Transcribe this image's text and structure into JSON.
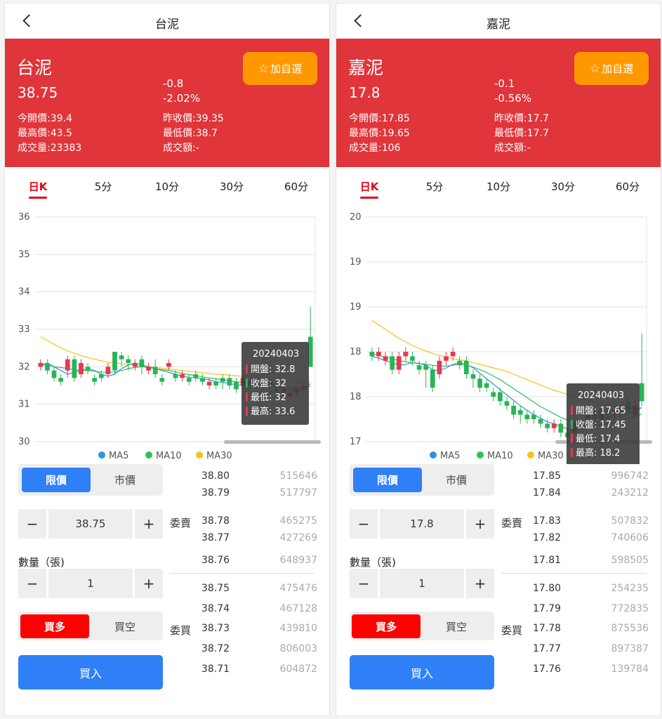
{
  "panels": [
    {
      "nav_title": "台泥",
      "quote": {
        "name": "台泥",
        "price": "38.75",
        "change": "-0.8",
        "change_pct": "-2.02%",
        "open": "今開價:39.4",
        "prev_close": "昨收價:39.35",
        "high": "最高價:43.5",
        "low": "最低價:38.7",
        "volume": "成交量:23383",
        "amount": "成交額:-",
        "fav_label": "加自選"
      },
      "tabs": [
        "日K",
        "5分",
        "10分",
        "30分",
        "60分"
      ],
      "chart_data": {
        "type": "candlestick",
        "y_ticks": [
          "36",
          "35",
          "34",
          "33",
          "32",
          "31",
          "30"
        ],
        "ylim": [
          30,
          36
        ],
        "candles": [
          [
            32.0,
            32.1,
            31.9,
            32.2
          ],
          [
            32.1,
            31.9,
            31.8,
            32.2
          ],
          [
            31.9,
            31.7,
            31.6,
            32.0
          ],
          [
            31.7,
            31.6,
            31.5,
            31.8
          ],
          [
            31.9,
            32.2,
            31.7,
            32.3
          ],
          [
            32.2,
            31.7,
            31.6,
            32.3
          ],
          [
            31.8,
            32.1,
            31.7,
            32.2
          ],
          [
            32.0,
            31.9,
            31.8,
            32.1
          ],
          [
            31.7,
            31.6,
            31.5,
            31.8
          ],
          [
            31.8,
            31.7,
            31.6,
            31.9
          ],
          [
            31.8,
            32.0,
            31.7,
            32.1
          ],
          [
            32.4,
            31.9,
            31.8,
            32.4
          ],
          [
            32.3,
            32.2,
            32.0,
            32.4
          ],
          [
            32.2,
            32.1,
            31.9,
            32.3
          ],
          [
            32.0,
            32.1,
            31.9,
            32.2
          ],
          [
            32.2,
            32.0,
            31.8,
            32.3
          ],
          [
            31.9,
            32.0,
            31.8,
            32.1
          ],
          [
            32.0,
            31.8,
            31.7,
            32.2
          ],
          [
            31.7,
            31.6,
            31.5,
            31.8
          ],
          [
            32.0,
            32.1,
            31.9,
            32.2
          ],
          [
            31.8,
            31.7,
            31.6,
            31.9
          ],
          [
            31.7,
            31.8,
            31.6,
            31.9
          ],
          [
            31.7,
            31.6,
            31.5,
            31.8
          ],
          [
            31.8,
            31.7,
            31.6,
            31.9
          ],
          [
            31.7,
            31.6,
            31.5,
            31.8
          ],
          [
            31.5,
            31.6,
            31.4,
            31.7
          ],
          [
            31.6,
            31.5,
            31.4,
            31.7
          ],
          [
            31.7,
            31.6,
            31.4,
            31.8
          ],
          [
            31.7,
            31.5,
            31.4,
            31.8
          ],
          [
            31.6,
            31.4,
            31.3,
            31.7
          ],
          [
            31.5,
            31.7,
            31.4,
            31.8
          ],
          [
            31.6,
            31.5,
            31.4,
            31.7
          ],
          [
            31.6,
            31.7,
            31.5,
            31.8
          ],
          [
            31.7,
            31.5,
            31.4,
            31.8
          ],
          [
            31.6,
            31.5,
            31.3,
            31.6
          ],
          [
            31.4,
            31.3,
            31.2,
            31.5
          ],
          [
            31.3,
            31.4,
            31.2,
            31.5
          ],
          [
            31.2,
            31.3,
            31.1,
            31.4
          ],
          [
            31.3,
            31.4,
            31.2,
            31.5
          ],
          [
            31.4,
            31.5,
            31.3,
            31.6
          ],
          [
            32.8,
            32.0,
            32.0,
            33.6
          ]
        ],
        "ma5": [
          32.0,
          32.1,
          32.0,
          31.9,
          31.8,
          31.85,
          31.9,
          31.95,
          31.9,
          31.8,
          31.75,
          31.8,
          31.95,
          32.05,
          32.1,
          32.05,
          32.0,
          31.95,
          31.9,
          31.85,
          31.8,
          31.75,
          31.72,
          31.7,
          31.68,
          31.65,
          31.6,
          31.58,
          31.55,
          31.52,
          31.5,
          31.52,
          31.55,
          31.55,
          31.5,
          31.45,
          31.42,
          31.38,
          31.35,
          31.4,
          31.55
        ],
        "ma10": [
          32.1,
          32.05,
          32.0,
          31.98,
          31.95,
          31.92,
          31.9,
          31.9,
          31.88,
          31.86,
          31.85,
          31.86,
          31.9,
          31.95,
          31.98,
          32.0,
          31.98,
          31.95,
          31.92,
          31.9,
          31.86,
          31.82,
          31.79,
          31.76,
          31.73,
          31.7,
          31.68,
          31.65,
          31.62,
          31.6,
          31.58,
          31.57,
          31.56,
          31.55,
          31.52,
          31.5,
          31.47,
          31.44,
          31.42,
          31.42,
          31.48
        ],
        "ma30": [
          32.8,
          32.7,
          32.6,
          32.5,
          32.42,
          32.36,
          32.3,
          32.25,
          32.2,
          32.16,
          32.12,
          32.1,
          32.08,
          32.06,
          32.04,
          32.02,
          32.0,
          31.98,
          31.96,
          31.94,
          31.92,
          31.9,
          31.88,
          31.86,
          31.84,
          31.82,
          31.8,
          31.79,
          31.78,
          31.76,
          31.74,
          31.72,
          31.7,
          31.68,
          31.66,
          31.64,
          31.62,
          31.6,
          31.58,
          31.58,
          31.6
        ],
        "tooltip": {
          "date": "20240403",
          "open": "開盤: 32.8",
          "close": "收盤: 32",
          "low": "最低: 32",
          "high": "最高: 33.6"
        },
        "legend": [
          "MA5",
          "MA10",
          "MA30"
        ]
      },
      "order": {
        "type_limit": "限價",
        "type_market": "市價",
        "price_value": "38.75",
        "qty_label": "數量（張)",
        "qty_value": "1",
        "side_long": "買多",
        "side_short": "買空",
        "buy_label": "買入",
        "minus": "−",
        "plus": "+"
      },
      "book": {
        "ask_label": "委賣",
        "bid_label": "委買",
        "asks": [
          [
            "38.80",
            "515646"
          ],
          [
            "38.79",
            "517797"
          ],
          [
            "38.78",
            "465275"
          ],
          [
            "38.77",
            "427269"
          ],
          [
            "38.76",
            "648937"
          ]
        ],
        "bids": [
          [
            "38.75",
            "475476"
          ],
          [
            "38.74",
            "467128"
          ],
          [
            "38.73",
            "439810"
          ],
          [
            "38.72",
            "806003"
          ],
          [
            "38.71",
            "604872"
          ]
        ]
      }
    },
    {
      "nav_title": "嘉泥",
      "quote": {
        "name": "嘉泥",
        "price": "17.8",
        "change": "-0.1",
        "change_pct": "-0.56%",
        "open": "今開價:17.85",
        "prev_close": "昨收價:17.7",
        "high": "最高價:19.65",
        "low": "最低價:17.7",
        "volume": "成交量:106",
        "amount": "成交額:-",
        "fav_label": "加自選"
      },
      "tabs": [
        "日K",
        "5分",
        "10分",
        "30分",
        "60分"
      ],
      "chart_data": {
        "type": "candlestick",
        "y_ticks": [
          "20",
          "19",
          "19",
          "18",
          "18",
          "17"
        ],
        "ylim": [
          17,
          19.5
        ],
        "candles": [
          [
            18.0,
            17.95,
            17.9,
            18.05
          ],
          [
            17.95,
            18.0,
            17.9,
            18.05
          ],
          [
            17.9,
            17.95,
            17.85,
            18.0
          ],
          [
            17.95,
            17.8,
            17.75,
            18.0
          ],
          [
            17.8,
            17.95,
            17.75,
            18.0
          ],
          [
            17.95,
            18.0,
            17.9,
            18.05
          ],
          [
            17.95,
            17.9,
            17.85,
            18.0
          ],
          [
            17.85,
            17.8,
            17.75,
            17.9
          ],
          [
            17.85,
            17.8,
            17.6,
            17.9
          ],
          [
            17.8,
            17.6,
            17.55,
            17.85
          ],
          [
            17.75,
            17.9,
            17.7,
            17.95
          ],
          [
            17.9,
            17.95,
            17.85,
            18.0
          ],
          [
            17.95,
            18.0,
            17.9,
            18.05
          ],
          [
            17.9,
            17.85,
            17.8,
            17.95
          ],
          [
            17.9,
            17.75,
            17.7,
            17.95
          ],
          [
            17.75,
            17.7,
            17.6,
            17.8
          ],
          [
            17.7,
            17.6,
            17.55,
            17.75
          ],
          [
            17.65,
            17.6,
            17.55,
            17.7
          ],
          [
            17.55,
            17.5,
            17.45,
            17.6
          ],
          [
            17.55,
            17.45,
            17.4,
            17.6
          ],
          [
            17.45,
            17.4,
            17.35,
            17.5
          ],
          [
            17.4,
            17.3,
            17.25,
            17.45
          ],
          [
            17.35,
            17.3,
            17.2,
            17.4
          ],
          [
            17.3,
            17.25,
            17.2,
            17.35
          ],
          [
            17.3,
            17.25,
            17.2,
            17.35
          ],
          [
            17.25,
            17.2,
            17.15,
            17.3
          ],
          [
            17.2,
            17.15,
            17.1,
            17.25
          ],
          [
            17.15,
            17.2,
            17.1,
            17.25
          ],
          [
            17.2,
            17.1,
            17.05,
            17.25
          ],
          [
            17.1,
            17.05,
            17.0,
            17.15
          ],
          [
            17.1,
            17.2,
            17.05,
            17.25
          ],
          [
            17.2,
            17.15,
            17.1,
            17.25
          ],
          [
            17.2,
            17.3,
            17.15,
            17.35
          ],
          [
            17.3,
            17.25,
            17.2,
            17.35
          ],
          [
            17.25,
            17.35,
            17.2,
            17.4
          ],
          [
            17.35,
            17.3,
            17.25,
            17.4
          ],
          [
            17.3,
            17.35,
            17.25,
            17.4
          ],
          [
            17.35,
            17.3,
            17.25,
            17.4
          ],
          [
            17.45,
            17.35,
            17.3,
            17.5
          ],
          [
            17.3,
            17.4,
            17.25,
            17.45
          ],
          [
            17.65,
            17.45,
            17.4,
            18.2
          ]
        ],
        "ma5": [
          17.95,
          17.93,
          17.9,
          17.88,
          17.85,
          17.86,
          17.88,
          17.87,
          17.85,
          17.8,
          17.79,
          17.82,
          17.86,
          17.88,
          17.86,
          17.82,
          17.76,
          17.7,
          17.64,
          17.58,
          17.52,
          17.46,
          17.4,
          17.35,
          17.3,
          17.26,
          17.22,
          17.2,
          17.17,
          17.14,
          17.13,
          17.14,
          17.17,
          17.2,
          17.24,
          17.27,
          17.3,
          17.31,
          17.32,
          17.33,
          17.38
        ],
        "ma10": [
          17.98,
          17.96,
          17.94,
          17.92,
          17.9,
          17.89,
          17.88,
          17.87,
          17.86,
          17.85,
          17.84,
          17.84,
          17.85,
          17.86,
          17.85,
          17.83,
          17.8,
          17.77,
          17.73,
          17.69,
          17.64,
          17.59,
          17.54,
          17.49,
          17.44,
          17.39,
          17.35,
          17.31,
          17.27,
          17.24,
          17.21,
          17.19,
          17.18,
          17.18,
          17.19,
          17.2,
          17.22,
          17.24,
          17.26,
          17.28,
          17.31
        ],
        "ma30": [
          18.35,
          18.3,
          18.25,
          18.2,
          18.15,
          18.11,
          18.07,
          18.04,
          18.01,
          17.98,
          17.96,
          17.94,
          17.92,
          17.91,
          17.9,
          17.88,
          17.86,
          17.84,
          17.82,
          17.8,
          17.78,
          17.75,
          17.72,
          17.69,
          17.66,
          17.63,
          17.6,
          17.57,
          17.55,
          17.52,
          17.5,
          17.48,
          17.46,
          17.44,
          17.42,
          17.41,
          17.4,
          17.39,
          17.38,
          17.37,
          17.38
        ],
        "tooltip": {
          "date": "20240403",
          "open": "開盤: 17.65",
          "close": "收盤: 17.45",
          "low": "最低: 17.4",
          "high": "最高: 18.2"
        },
        "legend": [
          "MA5",
          "MA10",
          "MA30"
        ]
      },
      "order": {
        "type_limit": "限價",
        "type_market": "市價",
        "price_value": "17.8",
        "qty_label": "數量（張)",
        "qty_value": "1",
        "side_long": "買多",
        "side_short": "買空",
        "buy_label": "買入",
        "minus": "−",
        "plus": "+"
      },
      "book": {
        "ask_label": "委賣",
        "bid_label": "委買",
        "asks": [
          [
            "17.85",
            "996742"
          ],
          [
            "17.84",
            "243212"
          ],
          [
            "17.83",
            "507832"
          ],
          [
            "17.82",
            "740606"
          ],
          [
            "17.81",
            "598505"
          ]
        ],
        "bids": [
          [
            "17.80",
            "254235"
          ],
          [
            "17.79",
            "772835"
          ],
          [
            "17.78",
            "875536"
          ],
          [
            "17.77",
            "897387"
          ],
          [
            "17.76",
            "139784"
          ]
        ]
      }
    }
  ],
  "colors": {
    "quote_bg": "#e0353a",
    "fav_bg": "#ff9800",
    "up": "#e8384f",
    "down": "#27b556",
    "ma5": "#2f93e0",
    "ma10": "#2ebf5e",
    "ma30": "#f5c518",
    "primary": "#2f80f6",
    "buy_side": "#ff0000"
  }
}
